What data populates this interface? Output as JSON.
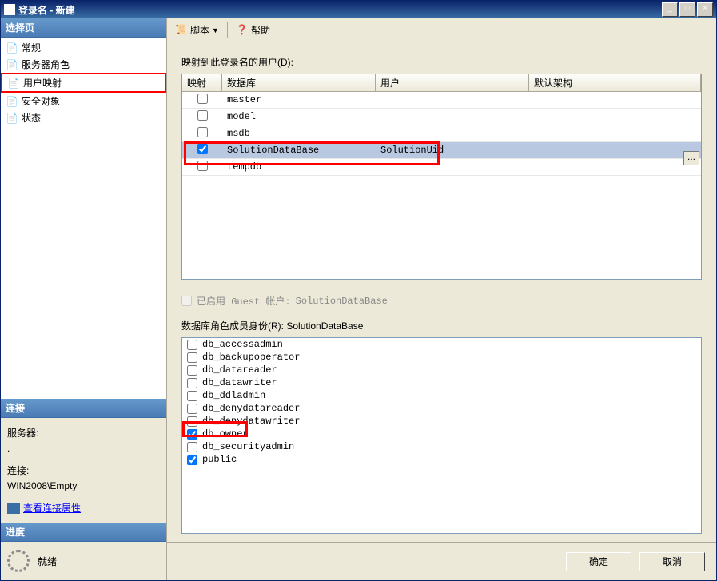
{
  "window": {
    "title": "登录名 - 新建"
  },
  "sidebar": {
    "select_header": "选择页",
    "items": [
      {
        "label": "常规"
      },
      {
        "label": "服务器角色"
      },
      {
        "label": "用户映射"
      },
      {
        "label": "安全对象"
      },
      {
        "label": "状态"
      }
    ],
    "connection_header": "连接",
    "server_label": "服务器:",
    "server_value": ".",
    "conn_label": "连接:",
    "conn_value": "WIN2008\\Empty",
    "view_props": "查看连接属性",
    "progress_header": "进度",
    "progress_status": "就绪"
  },
  "toolbar": {
    "script": "脚本",
    "help": "帮助"
  },
  "main": {
    "map_label": "映射到此登录名的用户(D):",
    "columns": {
      "map": "映射",
      "db": "数据库",
      "user": "用户",
      "schema": "默认架构"
    },
    "rows": [
      {
        "checked": false,
        "db": "master",
        "user": "",
        "schema": ""
      },
      {
        "checked": false,
        "db": "model",
        "user": "",
        "schema": ""
      },
      {
        "checked": false,
        "db": "msdb",
        "user": "",
        "schema": ""
      },
      {
        "checked": true,
        "db": "SolutionDataBase",
        "user": "SolutionUid",
        "schema": "",
        "selected": true
      },
      {
        "checked": false,
        "db": "tempdb",
        "user": "",
        "schema": ""
      }
    ],
    "guest_prefix": "已启用 Guest 帐户:",
    "guest_db": "SolutionDataBase",
    "roles_label_prefix": "数据库角色成员身份(R):",
    "roles_db": "SolutionDataBase",
    "roles": [
      {
        "name": "db_accessadmin",
        "checked": false
      },
      {
        "name": "db_backupoperator",
        "checked": false
      },
      {
        "name": "db_datareader",
        "checked": false
      },
      {
        "name": "db_datawriter",
        "checked": false
      },
      {
        "name": "db_ddladmin",
        "checked": false
      },
      {
        "name": "db_denydatareader",
        "checked": false
      },
      {
        "name": "db_denydatawriter",
        "checked": false
      },
      {
        "name": "db_owner",
        "checked": true
      },
      {
        "name": "db_securityadmin",
        "checked": false
      },
      {
        "name": "public",
        "checked": true
      }
    ]
  },
  "footer": {
    "ok": "确定",
    "cancel": "取消"
  }
}
